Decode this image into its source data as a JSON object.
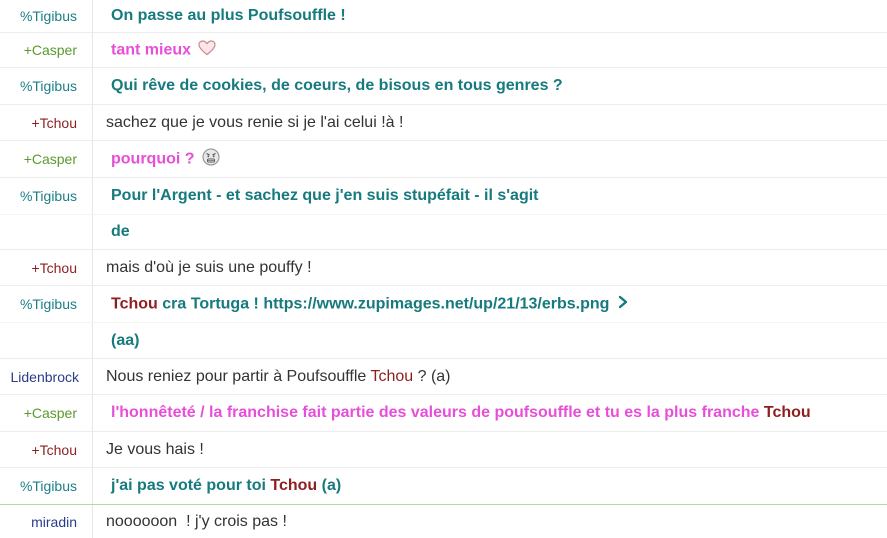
{
  "messages": [
    {
      "nick": "%Tigibus",
      "text": "On passe au plus Poufsouffle !"
    },
    {
      "nick": "+Casper",
      "text": "tant mieux"
    },
    {
      "nick": "%Tigibus",
      "text": "Qui rêve de cookies, de coeurs, de bisous en tous genres ?"
    },
    {
      "nick": "+Tchou",
      "text": "sachez que je vous renie si je l'ai celui !à !"
    },
    {
      "nick": "+Casper",
      "text": "pourquoi ?"
    },
    {
      "nick": "%Tigibus",
      "text": "Pour l'Argent - et sachez que j'en suis stupéfait - il s'agit"
    },
    {
      "nick": "",
      "text": "de"
    },
    {
      "nick": "+Tchou",
      "text": "mais d'où je suis une pouffy !"
    },
    {
      "nick": "%Tigibus",
      "mention": "Tchou",
      "text": " cra Tortuga ! ",
      "link": "https://www.zupimages.net/up/21/13/erbs.png"
    },
    {
      "nick": "",
      "text": "(aa)"
    },
    {
      "nick": "Lidenbrock",
      "text_before": "Nous reniez pour partir à Poufsouffle ",
      "mention": "Tchou",
      "text_after": " ? (a)"
    },
    {
      "nick": "+Casper",
      "text": "l'honnêteté / la franchise fait partie des valeurs de poufsouffle et tu es la plus franche ",
      "mention": "Tchou"
    },
    {
      "nick": "+Tchou",
      "text": "Je vous hais !"
    },
    {
      "nick": "%Tigibus",
      "text": "j'ai pas voté pour toi ",
      "mention": "Tchou",
      "text_after": " (a)"
    },
    {
      "nick": "miradin",
      "text": "noooooon  ! j'y crois pas !"
    }
  ],
  "icons": {
    "heart": "heart-icon",
    "angry": "angry-face-icon",
    "link": "chevron-right-icon"
  },
  "colors": {
    "tigibus": "#167a7e",
    "casper": "#e84fd8",
    "tchou": "#8e1f1f",
    "text": "#333333"
  }
}
